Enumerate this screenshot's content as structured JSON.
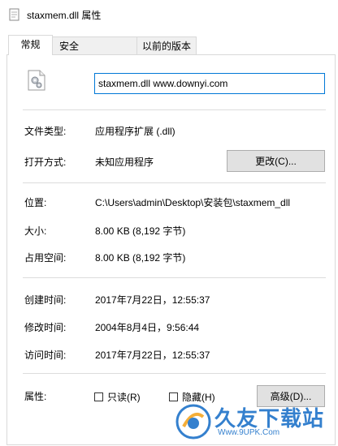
{
  "window": {
    "title": "staxmem.dll 属性",
    "icon": "file-properties-icon"
  },
  "tabs": [
    {
      "label": "常规",
      "active": true
    },
    {
      "label": "安全",
      "active": false
    },
    {
      "label": "以前的版本",
      "active": false
    }
  ],
  "general": {
    "file_icon": "dll-gear-file-icon",
    "filename_value": "staxmem.dll www.downyi.com",
    "file_type": {
      "label": "文件类型:",
      "value": "应用程序扩展 (.dll)"
    },
    "opens_with": {
      "label": "打开方式:",
      "value": "未知应用程序",
      "change_button": "更改(C)..."
    },
    "location": {
      "label": "位置:",
      "value": "C:\\Users\\admin\\Desktop\\安装包\\staxmem_dll"
    },
    "size": {
      "label": "大小:",
      "value": "8.00 KB (8,192 字节)"
    },
    "size_on_disk": {
      "label": "占用空间:",
      "value": "8.00 KB (8,192 字节)"
    },
    "created": {
      "label": "创建时间:",
      "value": "2017年7月22日，12:55:37"
    },
    "modified": {
      "label": "修改时间:",
      "value": "2004年8月4日，9:56:44"
    },
    "accessed": {
      "label": "访问时间:",
      "value": "2017年7月22日，12:55:37"
    },
    "attributes": {
      "label": "属性:",
      "readonly_label": "只读(R)",
      "readonly_checked": false,
      "hidden_label": "隐藏(H)",
      "hidden_checked": false,
      "advanced_button": "高级(D)..."
    }
  },
  "watermark": {
    "title": "久友下载站",
    "subtitle": "Www.9UPK.Com"
  },
  "colors": {
    "accent": "#0078d7",
    "watermark": "#1f73c9"
  }
}
